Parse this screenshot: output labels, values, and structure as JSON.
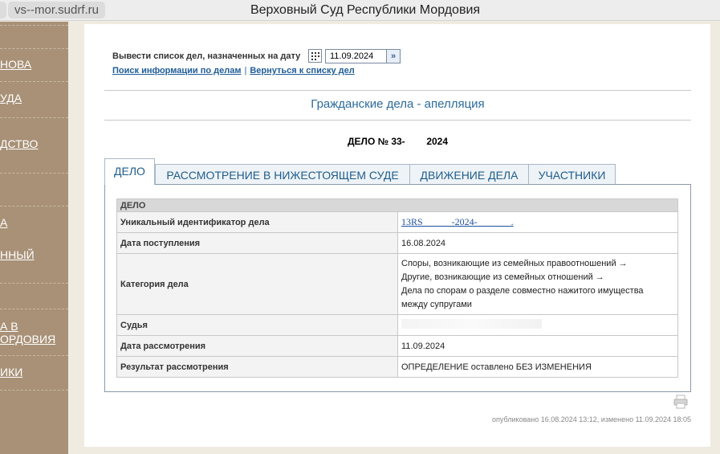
{
  "browser": {
    "url": "vs--mor.sudrf.ru",
    "title": "Верховный Суд Республики Мордовия"
  },
  "sidebar": {
    "items": [
      {
        "label": "НОВА"
      },
      {
        "label": "УДА"
      },
      {
        "label": "ДСТВО"
      },
      {
        "label": "А"
      },
      {
        "label": "ННЫЙ"
      },
      {
        "label": "А В"
      },
      {
        "label": "ОРДОВИЯ"
      },
      {
        "label": "ИКИ"
      }
    ]
  },
  "date_filter": {
    "label": "Вывести список дел, назначенных на дату",
    "date_value": "11.09.2024",
    "go_icon": "double-chevron-right-icon",
    "calendar_icon": "calendar-icon"
  },
  "links": {
    "search": "Поиск информации по делам",
    "separator": "|",
    "back": "Вернуться к списку дел"
  },
  "section_title": "Гражданские дела - апелляция",
  "case_number": "ДЕЛО № 33-        2024",
  "tabs": [
    {
      "label": "ДЕЛО",
      "active": true
    },
    {
      "label": "РАССМОТРЕНИЕ В НИЖЕСТОЯЩЕМ СУДЕ",
      "active": false
    },
    {
      "label": "ДВИЖЕНИЕ ДЕЛА",
      "active": false
    },
    {
      "label": "УЧАСТНИКИ",
      "active": false
    }
  ],
  "table": {
    "header": "ДЕЛО",
    "rows": [
      {
        "label": "Уникальный идентификатор дела",
        "value": "13RS            -2024-              ."
      },
      {
        "label": "Дата поступления",
        "value": "16.08.2024"
      },
      {
        "label": "Категория дела",
        "lines": [
          "Споры, возникающие из семейных правоотношений →",
          "Другие, возникающие из семейных отношений →",
          "Дела по спорам о разделе совместно нажитого имущества",
          "между супругами"
        ]
      },
      {
        "label": "Судья",
        "value": ""
      },
      {
        "label": "Дата рассмотрения",
        "value": "11.09.2024"
      },
      {
        "label": "Результат рассмотрения",
        "value": "ОПРЕДЕЛЕНИЕ оставлено БЕЗ ИЗМЕНЕНИЯ"
      }
    ]
  },
  "print_icon": "printer-icon",
  "footer": "опубликовано 16.08.2024 13:12, изменено 11.09.2024 18:05",
  "colors": {
    "sidebar": "#a89177",
    "link": "#1f5c99",
    "title": "#2c6ba0",
    "page_bg": "#f0ebe1"
  }
}
